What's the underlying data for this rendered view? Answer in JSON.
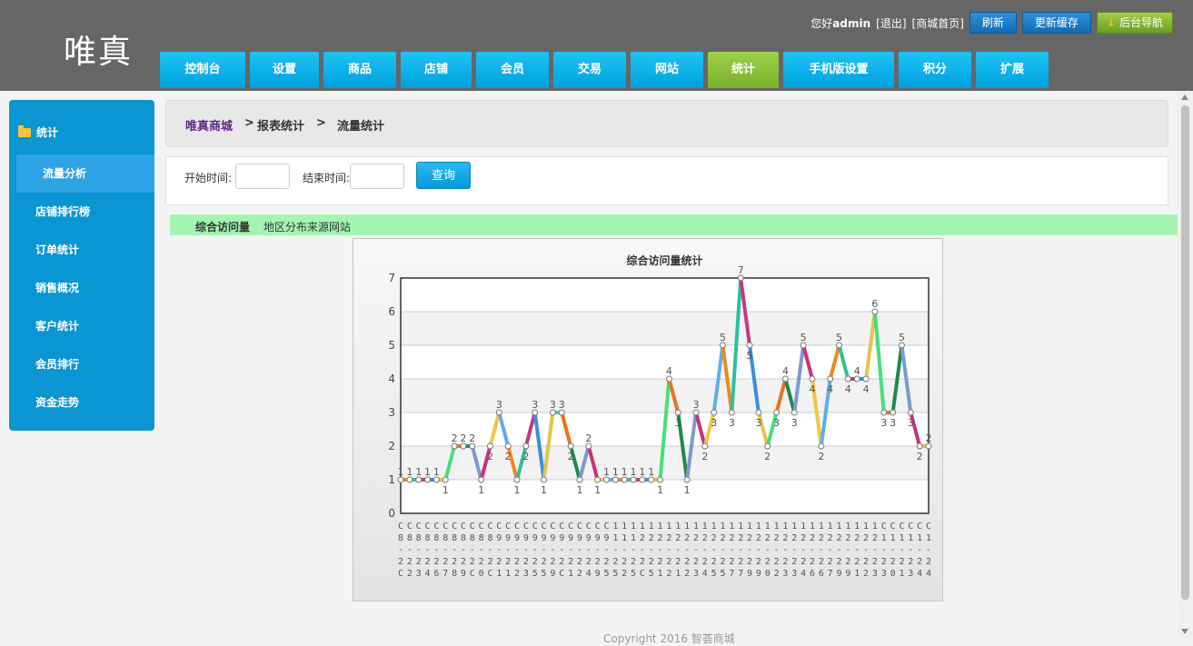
{
  "logo": "唯真",
  "header": {
    "greeting_prefix": "您好",
    "username": "admin",
    "logout": "[退出]",
    "store_home": "[商城首页]",
    "refresh": "刷新",
    "update_cache": "更新缓存",
    "admin_nav": "后台导航"
  },
  "nav": [
    "控制台",
    "设置",
    "商品",
    "店铺",
    "会员",
    "交易",
    "网站",
    "统计",
    "手机版设置",
    "积分",
    "扩展"
  ],
  "sidebar": {
    "header": "统计",
    "items": [
      "流量分析",
      "店铺排行榜",
      "订单统计",
      "销售概况",
      "客户统计",
      "会员排行",
      "资金走势"
    ]
  },
  "breadcrumb": {
    "home": "唯真商城",
    "sep1": ">",
    "level1": "报表统计",
    "sep2": ">",
    "current": "流量统计"
  },
  "filter": {
    "start_label": "开始时间:",
    "end_label": "结束时间:",
    "query_button": "查询"
  },
  "tabs": {
    "active": "综合访问量",
    "other": "地区分布来源网站"
  },
  "colors": {
    "topbar": "#666666",
    "nav": "#00a0e0",
    "nav_active": "#8bc34a",
    "sidebar": "#0a96d2",
    "tabbar": "#a4f4b2"
  },
  "chart_data": {
    "type": "line",
    "title": "综合访问量统计",
    "ylim": [
      0,
      7
    ],
    "yticks": [
      0,
      1,
      2,
      3,
      4,
      5,
      6,
      7
    ],
    "grid": true,
    "values": [
      1,
      1,
      1,
      1,
      1,
      1,
      2,
      2,
      2,
      1,
      2,
      3,
      2,
      1,
      2,
      3,
      1,
      3,
      3,
      2,
      1,
      2,
      1,
      1,
      1,
      1,
      1,
      1,
      1,
      1,
      4,
      3,
      1,
      3,
      2,
      3,
      5,
      3,
      7,
      5,
      3,
      2,
      3,
      4,
      3,
      5,
      4,
      2,
      4,
      5,
      4,
      4,
      4,
      6,
      3,
      3,
      5,
      3,
      2,
      2
    ],
    "x_label_rows": [
      "CCCCCCCCCCCCCCCCCCCCCCCC111111111111111111111111111111CCCCCC",
      "888888888889999999999999111222222222222222222222222222111111",
      "------------------------------------------------------------",
      "222222222222222222222222222222222222222222222222222222222222",
      "C2346789C0C1123559C12495525C512123455779902334667991233013446786",
      ""
    ]
  },
  "copyright": "Copyright 2016 智荟商城"
}
